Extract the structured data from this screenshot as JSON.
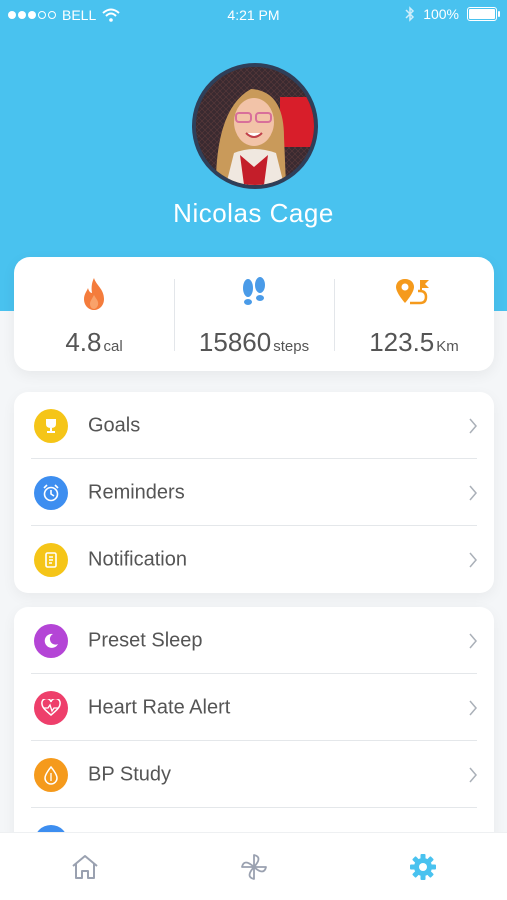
{
  "status_bar": {
    "carrier": "BELL",
    "time": "4:21 PM",
    "battery": "100%"
  },
  "profile": {
    "name": "Nicolas Cage"
  },
  "stats": [
    {
      "value": "4.8",
      "unit": "cal",
      "icon": "flame-icon"
    },
    {
      "value": "15860",
      "unit": "steps",
      "icon": "footsteps-icon"
    },
    {
      "value": "123.5",
      "unit": "Km",
      "icon": "route-pin-icon"
    }
  ],
  "menu_group_1": [
    {
      "label": "Goals",
      "icon": "trophy-icon",
      "color": "#f5c518"
    },
    {
      "label": "Reminders",
      "icon": "alarm-clock-icon",
      "color": "#3d8ef0"
    },
    {
      "label": "Notification",
      "icon": "note-icon",
      "color": "#f5c518"
    }
  ],
  "menu_group_2": [
    {
      "label": "Preset Sleep",
      "icon": "moon-icon",
      "color": "#b445d6"
    },
    {
      "label": "Heart Rate Alert",
      "icon": "heart-pulse-icon",
      "color": "#ee3f6b"
    },
    {
      "label": "BP Study",
      "icon": "drop-icon",
      "color": "#f59a1c"
    }
  ],
  "tabs": [
    {
      "icon": "home-icon"
    },
    {
      "icon": "pinwheel-icon"
    },
    {
      "icon": "gear-icon",
      "active": true
    }
  ],
  "colors": {
    "header": "#49c2ef",
    "active_tab": "#49c2ef",
    "inactive_tab": "#9aa1b0"
  }
}
